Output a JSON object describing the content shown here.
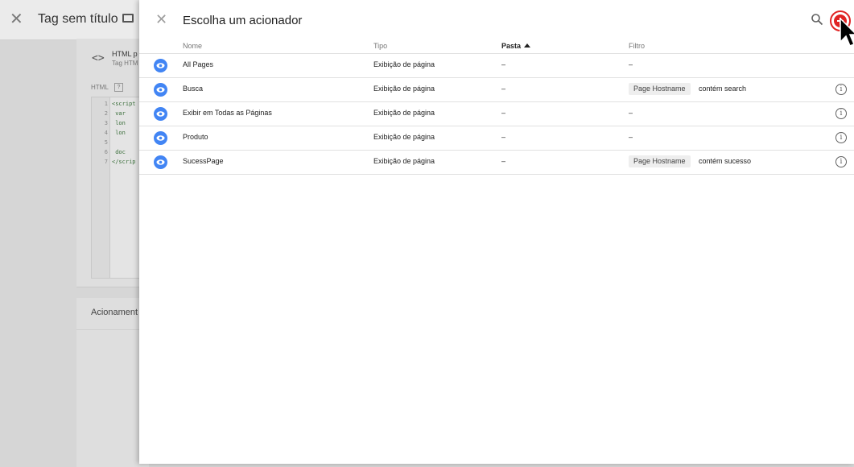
{
  "background": {
    "title": "Tag sem título",
    "tag_name": "HTML p",
    "tag_type": "Tag HTM",
    "html_label": "HTML",
    "help_icon": "?",
    "code_lines": [
      {
        "num": "1",
        "code": "<script"
      },
      {
        "num": "2",
        "code": "    var"
      },
      {
        "num": "3",
        "code": "    lon"
      },
      {
        "num": "4",
        "code": "    lon"
      },
      {
        "num": "5",
        "code": ""
      },
      {
        "num": "6",
        "code": "    doc"
      },
      {
        "num": "7",
        "code": "</scrip"
      }
    ],
    "triggering_label": "Acionament"
  },
  "panel": {
    "title": "Escolha um acionador",
    "columns": {
      "name": "Nome",
      "type": "Tipo",
      "folder": "Pasta",
      "filter": "Filtro"
    },
    "rows": [
      {
        "name": "All Pages",
        "type": "Exibição de página",
        "folder": "–",
        "filter_text": "–",
        "chip": ""
      },
      {
        "name": "Busca",
        "type": "Exibição de página",
        "folder": "–",
        "filter_text": "contém search",
        "chip": "Page Hostname"
      },
      {
        "name": "Exibir em Todas as Páginas",
        "type": "Exibição de página",
        "folder": "–",
        "filter_text": "–",
        "chip": ""
      },
      {
        "name": "Produto",
        "type": "Exibição de página",
        "folder": "–",
        "filter_text": "–",
        "chip": ""
      },
      {
        "name": "SucessPage",
        "type": "Exibição de página",
        "folder": "–",
        "filter_text": "contém sucesso",
        "chip": "Page Hostname"
      }
    ],
    "info_glyph": "i"
  },
  "colors": {
    "accent": "#4285f4",
    "highlight": "#e02424"
  }
}
